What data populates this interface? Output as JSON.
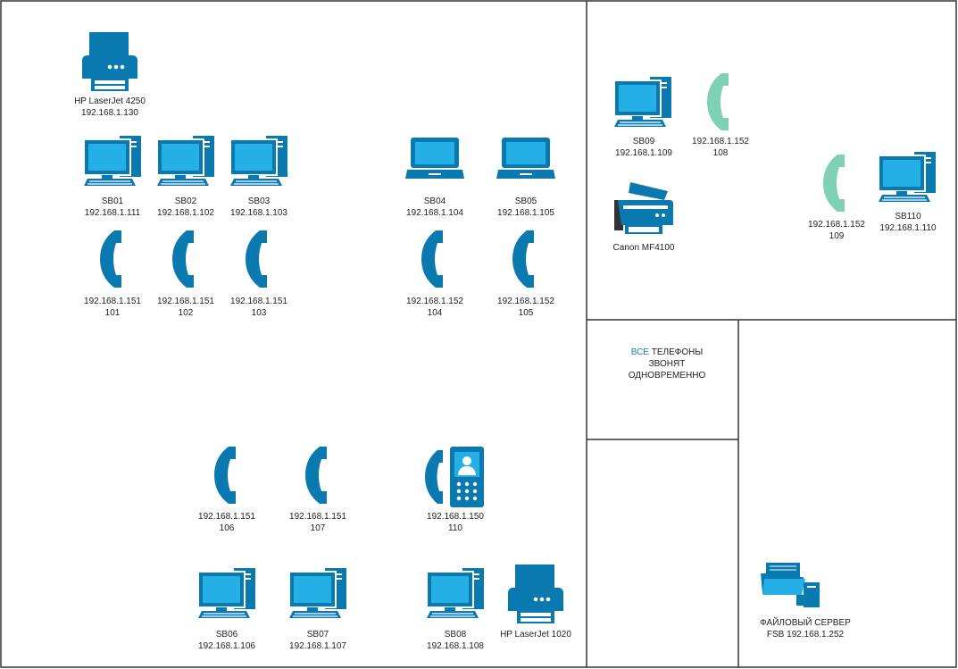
{
  "colors": {
    "primary": "#0a79b0",
    "screen": "#24b0e6",
    "highlight_phone": "#7fd1b4",
    "border": "#333333"
  },
  "printers": [
    {
      "name": "HP LaserJet 4250",
      "ip": "192.168.1.130"
    },
    {
      "name": "HP LaserJet  1020",
      "ip": ""
    }
  ],
  "workstations": [
    {
      "name": "SB01",
      "ip": "192.168.1.111",
      "icon": "desktop-icon"
    },
    {
      "name": "SB02",
      "ip": "192.168.1.102",
      "icon": "desktop-icon"
    },
    {
      "name": "SB03",
      "ip": "192.168.1.103",
      "icon": "desktop-icon"
    },
    {
      "name": "SB04",
      "ip": "192.168.1.104",
      "icon": "laptop-icon"
    },
    {
      "name": "SB05",
      "ip": "192.168.1.105",
      "icon": "laptop-icon"
    },
    {
      "name": "SB06",
      "ip": "192.168.1.106",
      "icon": "desktop-icon"
    },
    {
      "name": "SB07",
      "ip": "192.168.1.107",
      "icon": "desktop-icon"
    },
    {
      "name": "SB08",
      "ip": "192.168.1.108",
      "icon": "desktop-icon"
    },
    {
      "name": "SB09",
      "ip": "192.168.1.109",
      "icon": "desktop-icon"
    },
    {
      "name": "SB110",
      "ip": "192.168.1.110",
      "icon": "desktop-icon"
    }
  ],
  "phones": [
    {
      "ip": "192.168.1.151",
      "ext": "101",
      "style": "primary"
    },
    {
      "ip": "192.168.1.151",
      "ext": "102",
      "style": "primary"
    },
    {
      "ip": "192.168.1.151",
      "ext": "103",
      "style": "primary"
    },
    {
      "ip": "192.168.1.152",
      "ext": "104",
      "style": "primary"
    },
    {
      "ip": "192.168.1.152",
      "ext": "105",
      "style": "primary"
    },
    {
      "ip": "192.168.1.151",
      "ext": "106",
      "style": "primary"
    },
    {
      "ip": "192.168.1.151",
      "ext": "107",
      "style": "primary"
    },
    {
      "ip": "192.168.1.150",
      "ext": "110",
      "style": "video-phone"
    },
    {
      "ip": "192.168.1.152",
      "ext": "108",
      "style": "highlight"
    },
    {
      "ip": "192.168.1.152",
      "ext": "109",
      "style": "highlight"
    }
  ],
  "mfp": {
    "name": "Canon MF4100"
  },
  "note": {
    "accent": "ВСЕ",
    "rest": " ТЕЛЕФОНЫ",
    "line2": "ЗВОНЯТ",
    "line3": "ОДНОВРЕМЕННО"
  },
  "file_server": {
    "line1": "ФАЙЛОВЫЙ СЕРВЕР",
    "line2": "FSB 192.168.1.252"
  }
}
